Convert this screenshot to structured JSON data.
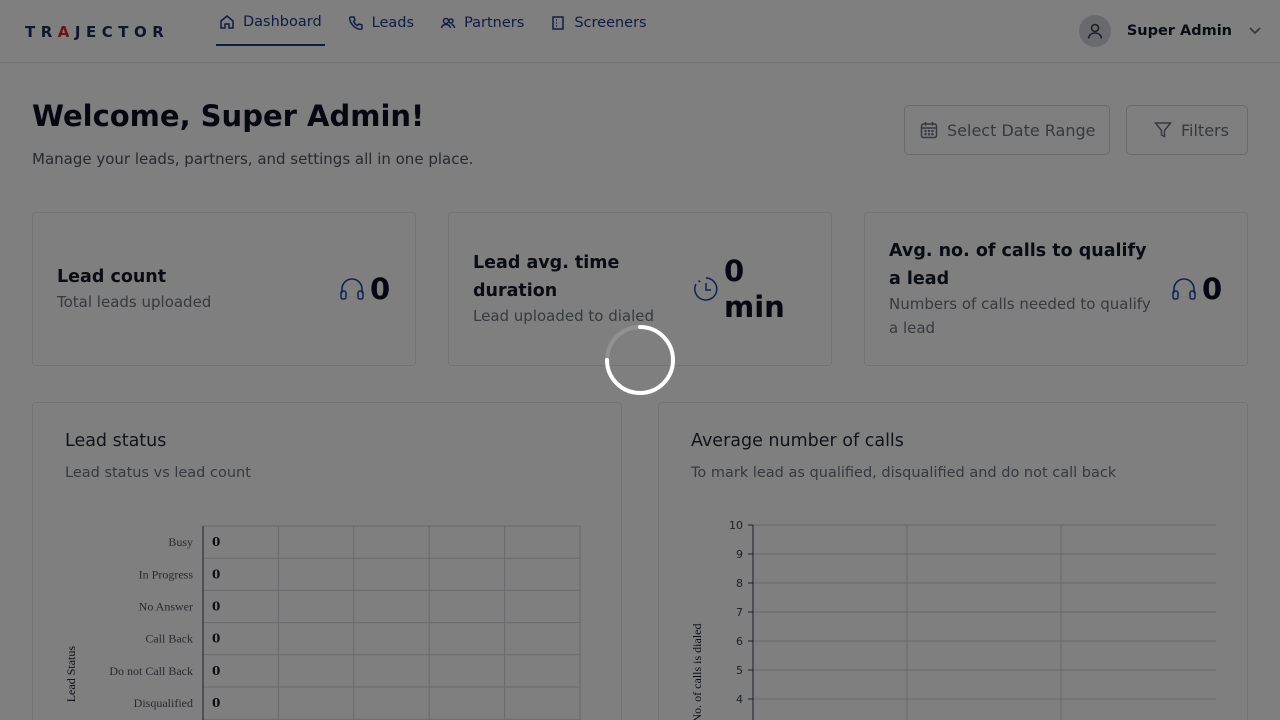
{
  "brand": {
    "logo_pre": "TR",
    "logo_accent": "A",
    "logo_post": "JECTOR"
  },
  "nav": [
    {
      "label": "Dashboard",
      "icon": "home-icon",
      "active": true
    },
    {
      "label": "Leads",
      "icon": "phone-icon"
    },
    {
      "label": "Partners",
      "icon": "users-icon"
    },
    {
      "label": "Screeners",
      "icon": "building-icon"
    }
  ],
  "user": {
    "name": "Super Admin"
  },
  "header": {
    "title": "Welcome, Super Admin!",
    "subtitle": "Manage your leads, partners, and settings all in one place.",
    "date_range_label": "Select Date Range",
    "filters_label": "Filters"
  },
  "kpis": [
    {
      "title": "Lead count",
      "description": "Total leads uploaded",
      "value": "0",
      "icon": "headset-icon"
    },
    {
      "title_line1": "Lead avg. time",
      "title_line2": "duration",
      "description": "Lead uploaded to dialed",
      "value_line1": "0",
      "value_line2": "min",
      "icon": "timer-icon"
    },
    {
      "title_line1": "Avg. no. of calls to qualify",
      "title_line2": "a lead",
      "description_line1": "Numbers of calls needed to qualify",
      "description_line2": "a lead",
      "value": "0",
      "icon": "headset-icon"
    }
  ],
  "charts": {
    "lead_status": {
      "title": "Lead status",
      "subtitle": "Lead status vs lead count"
    },
    "avg_calls": {
      "title": "Average number of calls",
      "subtitle": "To mark lead as qualified, disqualified and do not call back"
    }
  },
  "chart_data": [
    {
      "type": "bar",
      "orientation": "horizontal",
      "categories": [
        "Busy",
        "In Progress",
        "No Answer",
        "Call Back",
        "Do not Call Back",
        "Disqualified"
      ],
      "values": [
        0,
        0,
        0,
        0,
        0,
        0
      ],
      "ylabel": "Lead Status",
      "grid": true
    },
    {
      "type": "bar",
      "y_ticks": [
        10,
        9,
        8,
        7,
        6,
        5,
        4
      ],
      "ylim": [
        0,
        10
      ],
      "ylabel": "No. of calls is dialed",
      "grid": true
    }
  ],
  "colors": {
    "nav": "#1e3a8a",
    "icon": "#1e40af",
    "overlay": "rgba(0,0,0,0.5)"
  }
}
